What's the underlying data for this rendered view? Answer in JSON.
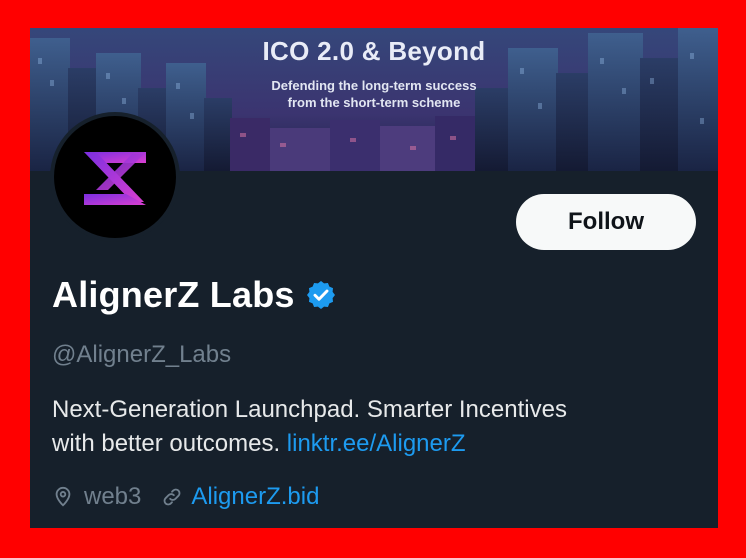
{
  "banner": {
    "title": "ICO 2.0 & Beyond",
    "subtitle_line1": "Defending the long-term success",
    "subtitle_line2": "from the short-term scheme"
  },
  "profile": {
    "name": "AlignerZ Labs",
    "handle": "@AlignerZ_Labs",
    "bio_text_line1": "Next-Generation Launchpad.  Smarter Incentives",
    "bio_text_line2": "with better outcomes.",
    "bio_link": "linktr.ee/AlignerZ",
    "location": "web3",
    "website": "AlignerZ.bid",
    "verified": true
  },
  "actions": {
    "follow_label": "Follow"
  },
  "colors": {
    "link": "#1d9bf0",
    "verified": "#1d9bf0",
    "background": "#16202b",
    "frame": "#ff0000"
  }
}
